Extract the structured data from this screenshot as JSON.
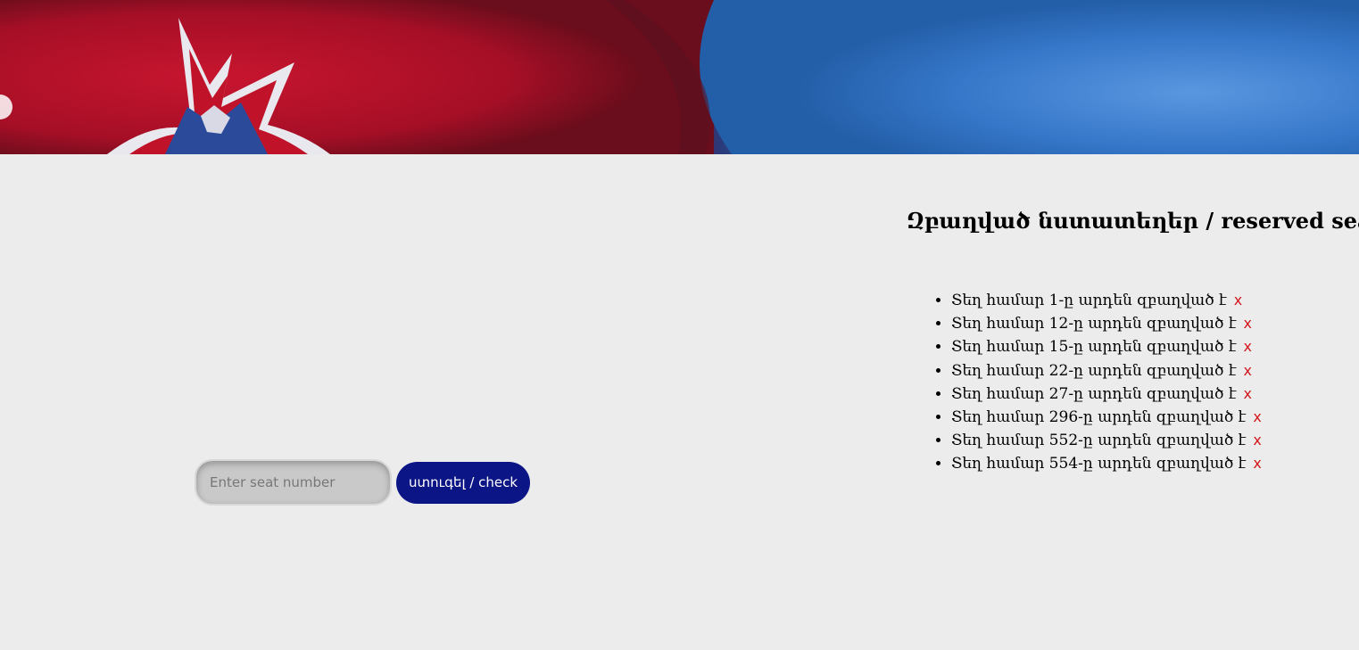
{
  "banner": {
    "left_color": "#b3122a",
    "right_color": "#3a7ed0"
  },
  "seat_check": {
    "input_value": "",
    "input_placeholder": "Enter seat number",
    "button_label": "ստուգել / check",
    "button_color": "#0c1586"
  },
  "reserved": {
    "title": "Զբաղված նստատեղեր / reserved seat",
    "remove_label": "x",
    "remove_color": "#d4171c",
    "items": [
      {
        "text": "Տեղ համար 1-ը արդեն զբաղված է"
      },
      {
        "text": "Տեղ համար 12-ը արդեն զբաղված է"
      },
      {
        "text": "Տեղ համար 15-ը արդեն զբաղված է"
      },
      {
        "text": "Տեղ համար 22-ը արդեն զբաղված է"
      },
      {
        "text": "Տեղ համար 27-ը արդեն զբաղված է"
      },
      {
        "text": "Տեղ համար 296-ը արդեն զբաղված է"
      },
      {
        "text": "Տեղ համար 552-ը արդեն զբաղված է"
      },
      {
        "text": "Տեղ համար 554-ը արդեն զբաղված է"
      }
    ]
  }
}
